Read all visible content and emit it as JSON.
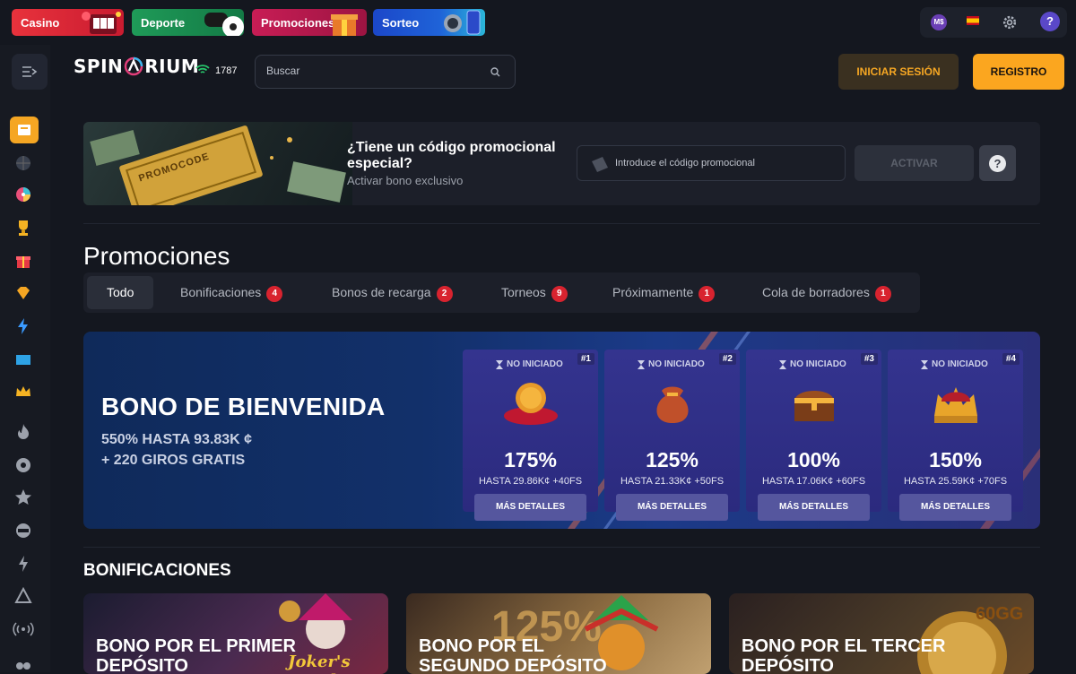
{
  "categories": [
    "Casino",
    "Deporte",
    "Promociones",
    "Sorteo"
  ],
  "top_right": {
    "currency": "M$",
    "currency_color": "#6a3fb5",
    "flag": "es-flag",
    "settings_icon": "gear-icon",
    "help_icon": "help-chat-icon"
  },
  "header": {
    "logo_left": "SPIN",
    "logo_right": "RIUM",
    "online_count": "1787",
    "search_placeholder": "Buscar",
    "login_label": "INICIAR SESIÓN",
    "register_label": "REGISTRO"
  },
  "sidebar_icons": [
    "menu-collapse-icon",
    "ticket-icon",
    "basketball-icon",
    "wheel-icon",
    "trophy-icon",
    "gift-icon",
    "gem-icon",
    "lightning-icon",
    "cards-icon",
    "crown-icon",
    "flame-icon",
    "soccer-icon",
    "star-icon",
    "new-icon",
    "bolt-icon",
    "aviator-icon",
    "live-icon",
    "cherries-icon"
  ],
  "promo": {
    "title": "¿Tiene un código promocional especial?",
    "subtitle": "Activar bono exclusivo",
    "image_text": "PROMOCODE",
    "input_placeholder": "Introduce el código promocional",
    "activate_label": "ACTIVAR",
    "help_label": "?"
  },
  "page_title": "Promociones",
  "tabs": [
    {
      "label": "Todo"
    },
    {
      "label": "Bonificaciones",
      "count": "4"
    },
    {
      "label": "Bonos de recarga",
      "count": "2"
    },
    {
      "label": "Torneos",
      "count": "9"
    },
    {
      "label": "Próximamente",
      "count": "1"
    },
    {
      "label": "Cola de borradores",
      "count": "1"
    }
  ],
  "welcome": {
    "title": "BONO DE BIENVENIDA",
    "line1": "550% HASTA 93.83K ¢",
    "line2": "+ 220 GIROS GRATIS",
    "cards": [
      {
        "num": "#1",
        "status": "NO INICIADO",
        "percent": "175%",
        "upto": "HASTA 29.86K¢ +40FS",
        "button": "MÁS DETALLES",
        "icon": "coin-pillow-icon"
      },
      {
        "num": "#2",
        "status": "NO INICIADO",
        "percent": "125%",
        "upto": "HASTA 21.33K¢ +50FS",
        "button": "MÁS DETALLES",
        "icon": "money-bag-icon"
      },
      {
        "num": "#3",
        "status": "NO INICIADO",
        "percent": "100%",
        "upto": "HASTA 17.06K¢ +60FS",
        "button": "MÁS DETALLES",
        "icon": "treasure-chest-icon"
      },
      {
        "num": "#4",
        "status": "NO INICIADO",
        "percent": "150%",
        "upto": "HASTA 25.59K¢ +70FS",
        "button": "MÁS DETALLES",
        "icon": "crown-icon"
      }
    ]
  },
  "bonificaciones": {
    "title": "BONIFICACIONES",
    "cards": [
      {
        "title": "BONO POR EL PRIMER DEPÓSITO",
        "art_text": "Joker's Jewels"
      },
      {
        "title": "BONO POR EL SEGUNDO DEPÓSITO",
        "art_text": "125%"
      },
      {
        "title": "BONO POR EL TERCER DEPÓSITO",
        "art_text": "60GG"
      }
    ]
  }
}
